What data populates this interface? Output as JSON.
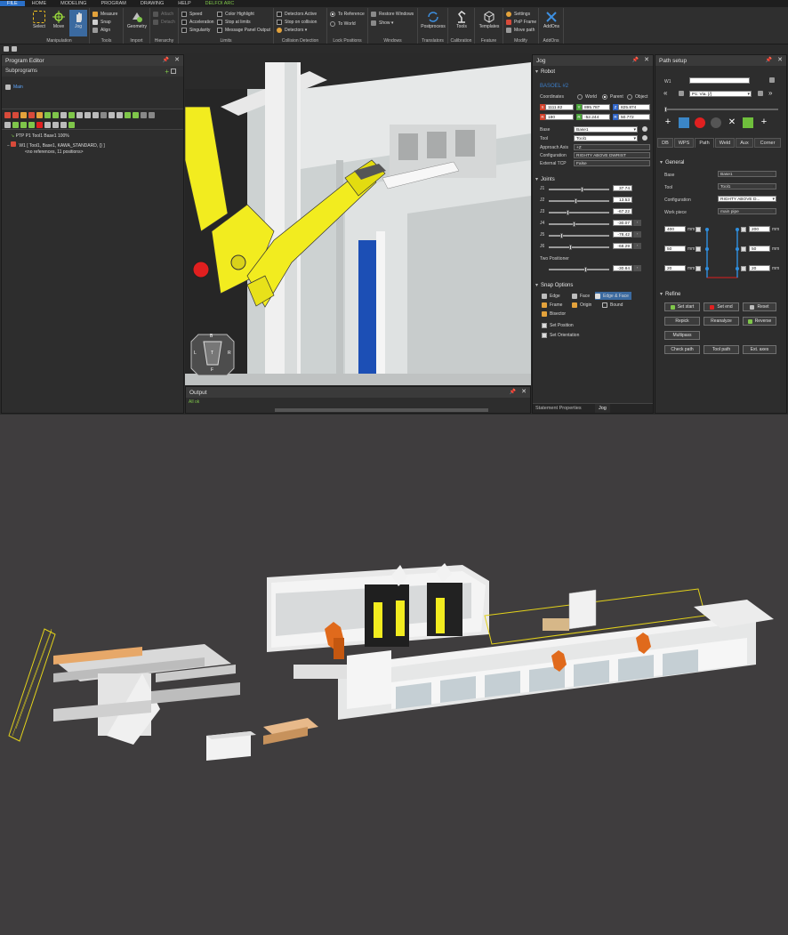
{
  "menu": [
    "FILE",
    "HOME",
    "MODELING",
    "PROGRAM",
    "DRAWING",
    "HELP",
    "DELFOI ARC"
  ],
  "ribbon": {
    "manipulation": {
      "label": "Manipulation",
      "select": "Select",
      "move": "Move",
      "jog": "Jog"
    },
    "tools": {
      "label": "Tools",
      "measure": "Measure",
      "snap": "Snap",
      "align": "Align"
    },
    "import": {
      "label": "Import",
      "geometry": "Geometry"
    },
    "hierarchy": {
      "label": "Hierarchy",
      "attach": "Attach",
      "detach": "Detach"
    },
    "limits": {
      "label": "Limits",
      "speed": "Speed",
      "acceleration": "Acceleration",
      "singularity": "Singularity",
      "color_highlight": "Color Highlight",
      "stop_at_limits": "Stop at limits",
      "message_panel_output": "Message Panel Output"
    },
    "collision": {
      "label": "Collision Detection",
      "detectors_active": "Detectors Active",
      "stop_on_collision": "Stop on collision",
      "detectors": "Detectors ▾"
    },
    "lock": {
      "label": "Lock Positions",
      "to_reference": "To Reference",
      "to_world": "To World"
    },
    "windows": {
      "label": "Windows",
      "restore": "Restore Windows",
      "show": "Show ▾"
    },
    "translators": {
      "label": "Translators",
      "postprocess": "Postprocess"
    },
    "calibration": {
      "label": "Calibration",
      "tools": "Tools"
    },
    "feature": {
      "label": "Feature",
      "templates": "Templates"
    },
    "modify": {
      "label": "Modify",
      "settings": "Settings",
      "pnp_frame": "PnP Frame",
      "move_path": "Move path"
    },
    "addons": {
      "label": "AddOns",
      "addons": "AddOns"
    }
  },
  "program_editor": {
    "title": "Program Editor",
    "subprograms": "Subprograms",
    "main": "Main",
    "lines": [
      "PTP P1 Tool1 Base1 100%",
      "W1  [ Tool1, Base1, KAWA_STANDARD, {} ]",
      "<no references, 11 positions>"
    ]
  },
  "output": {
    "title": "Output",
    "text": "All ok"
  },
  "viewcube": {
    "b": "B",
    "l": "L",
    "t": "T",
    "r": "R",
    "f": "F"
  },
  "jog": {
    "title": "Jog",
    "robot_section": "Robot",
    "robot_name": "BASOEL #2",
    "coordinates_label": "Coordinates",
    "coords": [
      "World",
      "Parent",
      "Object"
    ],
    "x": "1111.82",
    "y": "895.787",
    "z": "825.874",
    "rx": "180",
    "ry": "-52.244",
    "rz": "50.772",
    "base_label": "Base",
    "base": "Base1",
    "tool_label": "Tool",
    "tool": "Tool1",
    "approach_label": "Approach Axis",
    "approach": "+Z",
    "config_label": "Configuration",
    "config": "RIGHTY ABOVE DWRIST",
    "ext_tcp_label": "External TCP",
    "ext_tcp": "False",
    "joints_section": "Joints",
    "joints": [
      {
        "name": "J1",
        "value": "37.74",
        "pos": 0.55
      },
      {
        "name": "J2",
        "value": "13.53",
        "pos": 0.45
      },
      {
        "name": "J3",
        "value": "-67.22",
        "pos": 0.3
      },
      {
        "name": "J4",
        "value": "-30.07",
        "pos": 0.42
      },
      {
        "name": "J5",
        "value": "-78.42",
        "pos": 0.2
      },
      {
        "name": "J6",
        "value": "-68.29",
        "pos": 0.35
      }
    ],
    "unit": "°",
    "positioner_label": "Two Positioner",
    "positioner_value": "-30.84",
    "positioner_pos": 0.62,
    "snap_section": "Snap Options",
    "snap_edge": "Edge",
    "snap_face": "Face",
    "snap_edge_face": "Edge & Face",
    "snap_frame": "Frame",
    "snap_origin": "Origin",
    "snap_bound": "Bound",
    "snap_bisector": "Bisector",
    "set_position": "Set Position",
    "set_orientation": "Set Orientation",
    "tab_statement": "Statement Properties",
    "tab_jog": "Jog"
  },
  "path_setup": {
    "title": "Path setup",
    "w_label": "W1",
    "via": "P1: Via. [/]",
    "tabs": [
      "DB",
      "WPS",
      "Path",
      "Weld",
      "Aux",
      "Corner"
    ],
    "general_section": "General",
    "base_label": "Base",
    "base": "Base1",
    "tool_label": "Tool",
    "tool": "Tool1",
    "config_label": "Configuration",
    "config": "RIGHTY ABOVE D...",
    "workpiece_label": "Work piece",
    "workpiece": "main pipe",
    "left_vals": [
      "400",
      "50",
      "20"
    ],
    "right_vals": [
      "200",
      "50",
      "20"
    ],
    "mm": "mm",
    "refine_section": "Refine",
    "buttons": [
      "Set start",
      "Set end",
      "Reset",
      "Repick",
      "Reanalyze",
      "Reverse",
      "Multipass",
      "Check path",
      "Tool path",
      "Ext. axes"
    ]
  },
  "colors": {
    "accent": "#2a6fc7",
    "robot_yellow": "#f2ec1f",
    "scene_bg": "#3f3d3e"
  }
}
